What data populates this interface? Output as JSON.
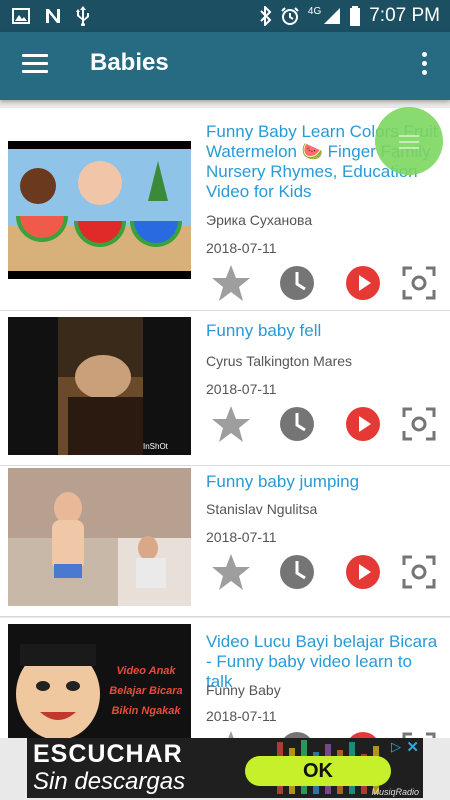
{
  "status_bar": {
    "time": "7:07 PM",
    "network": "4G"
  },
  "app_bar": {
    "title": "Babies"
  },
  "videos": [
    {
      "title": "Funny Baby Learn Colors Fruit Watermelon 🍉 Finger Family Nursery Rhymes, Education Video for Kids",
      "author": "Эрика Суханова",
      "date": "2018-07-11"
    },
    {
      "title": "Funny baby fell",
      "author": "Cyrus Talkington Mares",
      "date": "2018-07-11",
      "thumb_watermark": "InShOt"
    },
    {
      "title": "Funny baby jumping",
      "author": "Stanislav Ngulitsa",
      "date": "2018-07-11"
    },
    {
      "title": "Video Lucu Bayi belajar Bicara - Funny baby video learn to talk",
      "author": "Funny Baby",
      "date": "2018-07-11",
      "thumb_text": [
        "Video Anak",
        "Belajar Bicara",
        "Bikin Ngakak"
      ]
    }
  ],
  "ad": {
    "line1": "ESCUCHAR",
    "line2": "Sin descargas",
    "button": "OK",
    "brand": "MusiqRadio"
  },
  "colors": {
    "status_bar": "#1d4f63",
    "app_bar": "#276b82",
    "link": "#2a9ad6",
    "play_red": "#e53935",
    "fab_green": "#7cd65f"
  }
}
